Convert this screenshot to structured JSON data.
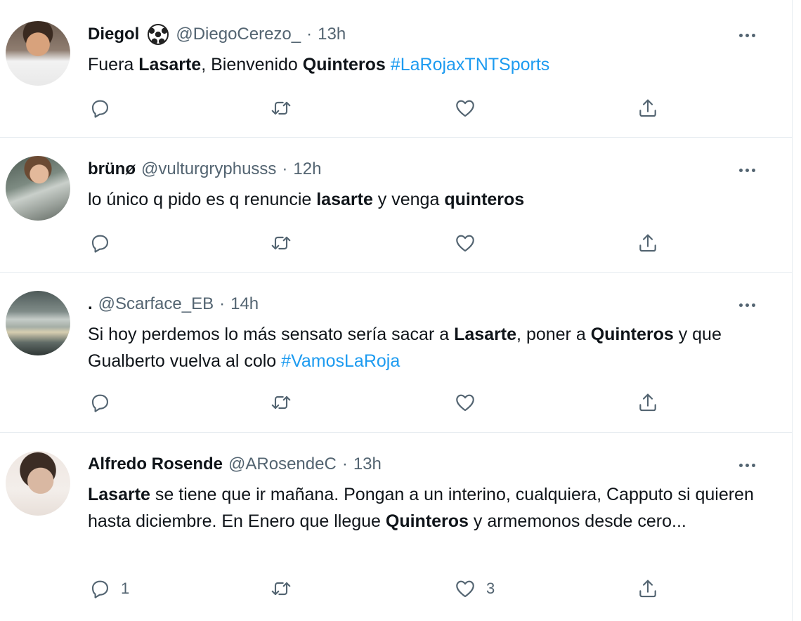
{
  "tweets": [
    {
      "name": "Diegol",
      "handle": "@DiegoCerezo_",
      "time": "13h",
      "text": [
        {
          "t": "Fuera "
        },
        {
          "t": "Lasarte",
          "b": true
        },
        {
          "t": ", Bienvenido "
        },
        {
          "t": "Quinteros",
          "b": true
        },
        {
          "t": " "
        },
        {
          "t": "#LaRojaxTNTSports",
          "tag": true
        }
      ],
      "reply_count": "",
      "like_count": ""
    },
    {
      "name": "brünø",
      "handle": "@vulturgryphusss",
      "time": "12h",
      "text": [
        {
          "t": "lo único q pido es q renuncie "
        },
        {
          "t": "lasarte",
          "b": true
        },
        {
          "t": " y venga "
        },
        {
          "t": "quinteros",
          "b": true
        }
      ],
      "reply_count": "",
      "like_count": ""
    },
    {
      "name": ".",
      "handle": "@Scarface_EB",
      "time": "14h",
      "text": [
        {
          "t": "Si hoy perdemos lo más sensato sería sacar a "
        },
        {
          "t": "Lasarte",
          "b": true
        },
        {
          "t": ", poner a "
        },
        {
          "t": "Quinteros",
          "b": true
        },
        {
          "t": " y que Gualberto vuelva al colo "
        },
        {
          "t": "#VamosLaRoja",
          "tag": true
        }
      ],
      "reply_count": "",
      "like_count": ""
    },
    {
      "name": "Alfredo Rosende",
      "handle": "@ARosendeC",
      "time": "13h",
      "text": [
        {
          "t": "Lasarte",
          "b": true
        },
        {
          "t": " se tiene que ir mañana. Pongan a un interino, cualquiera, Capputo si quieren hasta diciembre. En Enero que llegue "
        },
        {
          "t": "Quinteros",
          "b": true
        },
        {
          "t": " y armemonos desde cero..."
        }
      ],
      "reply_count": "1",
      "like_count": "3"
    }
  ],
  "dot_separator": "·",
  "icons": {
    "reply": "reply-icon",
    "retweet": "retweet-icon",
    "like": "heart-icon",
    "share": "share-icon",
    "more": "more-icon",
    "soccer": "soccer-ball-icon"
  },
  "colors": {
    "text": "#0f1419",
    "secondary": "#536471",
    "link": "#1d9bf0",
    "divider": "#e6ecf0"
  }
}
